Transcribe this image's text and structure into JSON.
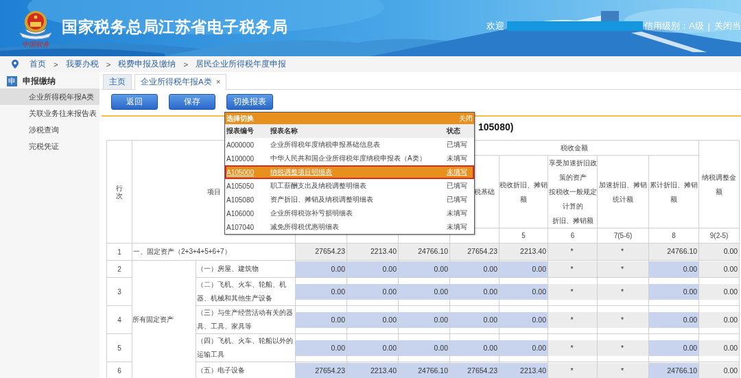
{
  "header": {
    "logo_text": "中国税务",
    "title": "国家税务总局江苏省电子税务局",
    "welcome": "欢迎",
    "credit": "信用级别：A级",
    "separator": "|",
    "close": "关闭当"
  },
  "breadcrumb": {
    "items": [
      "首页",
      "我要办税",
      "税费申报及缴纳",
      "居民企业所得税年度申报"
    ],
    "separator": ">"
  },
  "sidebar": {
    "section_icon": "申",
    "section": "申报缴纳",
    "items": [
      {
        "label": "企业所得税年报A类",
        "selected": true
      },
      {
        "label": "关联业务往来报告表",
        "selected": false
      },
      {
        "label": "涉税查询",
        "selected": false
      },
      {
        "label": "完税凭证",
        "selected": false
      }
    ]
  },
  "tabs": [
    {
      "label": "主页",
      "selected": false
    },
    {
      "label": "企业所得税年报A类",
      "selected": true,
      "close": "×"
    }
  ],
  "buttons": [
    "返回",
    "保存",
    "切换报表"
  ],
  "report_title": "105080)",
  "table": {
    "row_no_header": "行次",
    "item_header": "项目",
    "tax_group": "税收金额",
    "group_label": "所有固定资产",
    "columns": [
      {
        "input": true
      },
      {
        "input": true
      },
      {
        "input": true
      },
      {
        "label": "税基础",
        "input": true
      },
      {
        "label": "税收折旧、摊销额",
        "number": "5",
        "input": true
      },
      {
        "label_lines": [
          "享受加速折旧政",
          "策的资产",
          "按税收一般规定",
          "计算的",
          "折旧、摊销额"
        ],
        "number": "6",
        "input": false
      },
      {
        "label": "加速折旧、摊销统计额",
        "number": "7(5-6)",
        "input": false
      },
      {
        "label": "累计折旧、摊销额",
        "number": "8",
        "input": true
      },
      {
        "label": "纳税调整金额",
        "number": "9(2-5)",
        "input": false
      }
    ],
    "rows": [
      {
        "no": "1",
        "kind": "total",
        "label": "一、固定资产（2+3+4+5+6+7）",
        "values": [
          "27654.23",
          "2213.40",
          "24766.10",
          "27654.23",
          "2213.40",
          "*",
          "*",
          "24766.10",
          "0.00"
        ]
      },
      {
        "no": "2",
        "kind": "item",
        "label": "（一）房屋、建筑物",
        "values": [
          "0.00",
          "0.00",
          "0.00",
          "0.00",
          "0.00",
          "*",
          "*",
          "0.00",
          "0.00"
        ]
      },
      {
        "no": "3",
        "kind": "item",
        "label": "（二）飞机、火车、轮船、机器、机械和其他生产设备",
        "values": [
          "0.00",
          "0.00",
          "0.00",
          "0.00",
          "0.00",
          "*",
          "*",
          "0.00",
          "0.00"
        ]
      },
      {
        "no": "4",
        "kind": "item",
        "label": "（三）与生产经营活动有关的器具、工具、家具等",
        "values": [
          "0.00",
          "0.00",
          "0.00",
          "0.00",
          "0.00",
          "*",
          "*",
          "0.00",
          "0.00"
        ]
      },
      {
        "no": "5",
        "kind": "item",
        "label": "（四）飞机、火车、轮船以外的运输工具",
        "values": [
          "0.00",
          "0.00",
          "0.00",
          "0.00",
          "0.00",
          "*",
          "*",
          "0.00",
          "0.00"
        ]
      },
      {
        "no": "6",
        "kind": "item",
        "label": "（五）电子设备",
        "values": [
          "27654.23",
          "2213.40",
          "24766.10",
          "27654.23",
          "2213.40",
          "*",
          "*",
          "24766.10",
          "0.00"
        ]
      }
    ]
  },
  "popup": {
    "title": "选择切换",
    "close": "关闭",
    "columns": [
      "报表编号",
      "报表名称",
      "状态"
    ],
    "rows": [
      {
        "code": "A000000",
        "name": "企业所得税年度纳税申报基础信息表",
        "status": "已填写",
        "selected": false
      },
      {
        "code": "A100000",
        "name": "中华人民共和国企业所得税年度纳税申报表（A类）",
        "status": "未填写",
        "selected": false
      },
      {
        "code": "A105000",
        "name": "纳税调整项目明细表",
        "status": "未填写",
        "selected": true
      },
      {
        "code": "A105050",
        "name": "职工薪酬支出及纳税调整明细表",
        "status": "已填写",
        "selected": false
      },
      {
        "code": "A105080",
        "name": "资产折旧、摊销及纳税调整明细表",
        "status": "已填写",
        "selected": false
      },
      {
        "code": "A106000",
        "name": "企业所得税弥补亏损明细表",
        "status": "未填写",
        "selected": false
      },
      {
        "code": "A107040",
        "name": "减免所得税优惠明细表",
        "status": "未填写",
        "selected": false
      }
    ]
  }
}
